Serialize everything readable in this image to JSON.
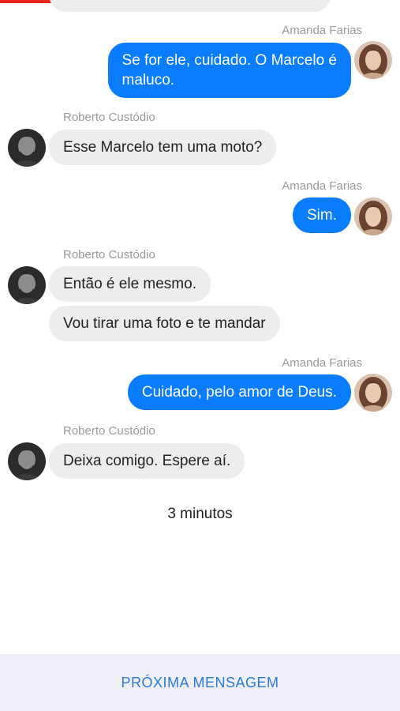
{
  "progress": {
    "fraction": 0.58,
    "color": "#e8251f"
  },
  "participants": {
    "me": "Amanda Farias",
    "them": "Roberto Custódio"
  },
  "messages": [
    {
      "sender": "Amanda Farias",
      "from": "me",
      "bubbles": [
        "Se for ele, cuidado. O Marcelo é\nmaluco."
      ]
    },
    {
      "sender": "Roberto Custódio",
      "from": "them",
      "bubbles": [
        "Esse Marcelo tem uma moto?"
      ]
    },
    {
      "sender": "Amanda Farias",
      "from": "me",
      "bubbles": [
        "Sim."
      ]
    },
    {
      "sender": "Roberto Custódio",
      "from": "them",
      "bubbles": [
        "Então é ele mesmo.",
        "Vou tirar uma foto e te mandar"
      ]
    },
    {
      "sender": "Amanda Farias",
      "from": "me",
      "bubbles": [
        "Cuidado, pelo amor de Deus."
      ]
    },
    {
      "sender": "Roberto Custódio",
      "from": "them",
      "bubbles": [
        "Deixa comigo. Espere aí."
      ]
    }
  ],
  "time_divider": "3 minutos",
  "footer": {
    "next_label": "PRÓXIMA MENSAGEM"
  },
  "colors": {
    "my_bubble": "#0a7cff",
    "their_bubble": "#ededed",
    "footer_bg": "#eeeff7",
    "link": "#2a7ad8"
  }
}
